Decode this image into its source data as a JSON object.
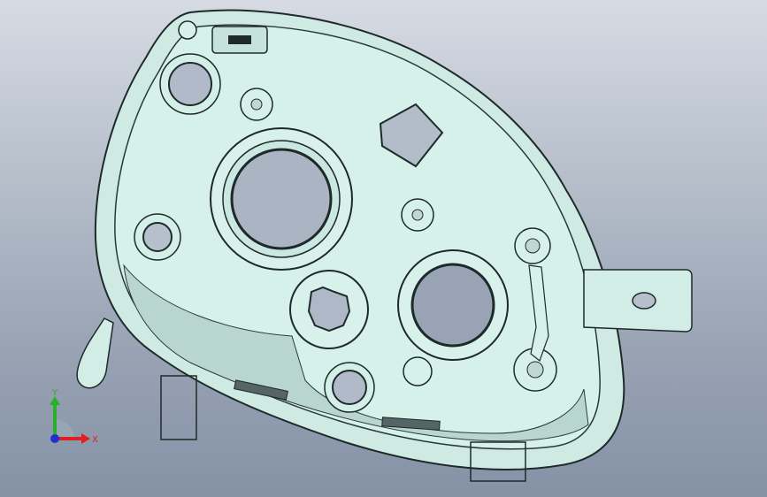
{
  "viewport": {
    "background_top": "#d6dbe3",
    "background_bottom": "#8592a6"
  },
  "model": {
    "name": "",
    "fill_color": "#d4eee8",
    "shadow_color": "#b8d6cf",
    "edge_color": "#1e2a2a"
  },
  "triad": {
    "x_label": "X",
    "y_label": "Y",
    "x_color": "#e02020",
    "y_color": "#28b028",
    "z_color": "#2030d0"
  }
}
